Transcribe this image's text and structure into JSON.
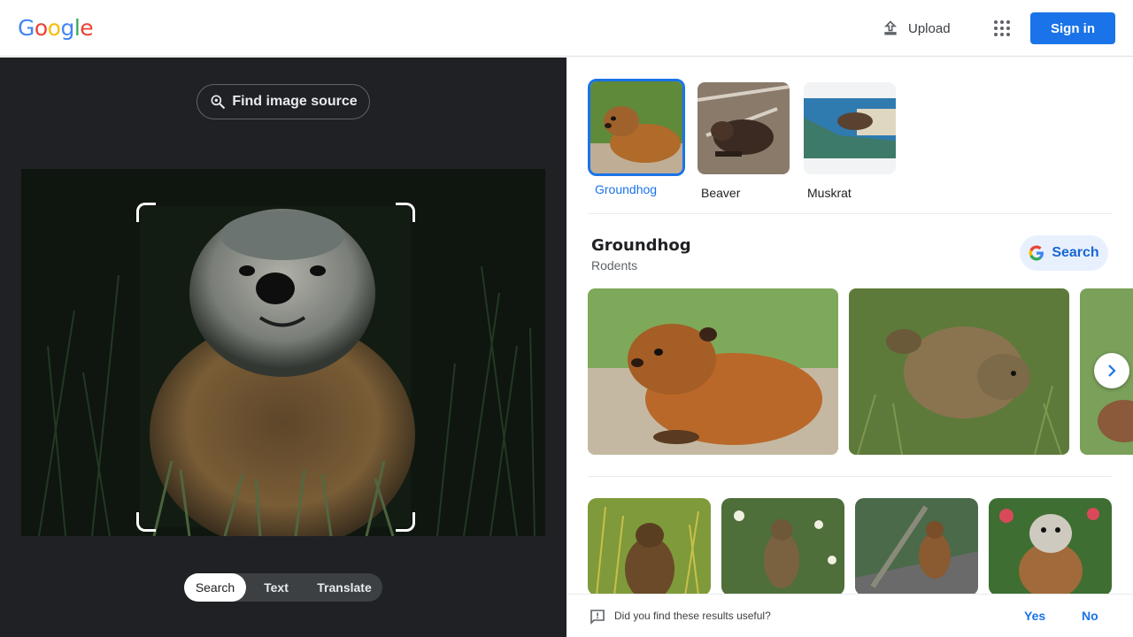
{
  "header": {
    "logo_letters": [
      "G",
      "o",
      "o",
      "g",
      "l",
      "e"
    ],
    "logo_colors": [
      "#4285F4",
      "#EA4335",
      "#FBBC05",
      "#4285F4",
      "#34A853",
      "#EA4335"
    ],
    "upload_label": "Upload",
    "signin_label": "Sign in",
    "accent": "#1a73e8"
  },
  "left_panel": {
    "find_source_label": "Find image source",
    "modes": [
      {
        "label": "Search",
        "active": true
      },
      {
        "label": "Text",
        "active": false
      },
      {
        "label": "Translate",
        "active": false
      }
    ]
  },
  "results": {
    "chips": [
      {
        "label": "Groundhog",
        "active": true
      },
      {
        "label": "Beaver",
        "active": false
      },
      {
        "label": "Muskrat",
        "active": false
      }
    ],
    "entity": {
      "title": "Groundhog",
      "subtitle": "Rodents",
      "search_label": "Search"
    },
    "feedback": {
      "question": "Did you find these results useful?",
      "yes": "Yes",
      "no": "No"
    }
  }
}
